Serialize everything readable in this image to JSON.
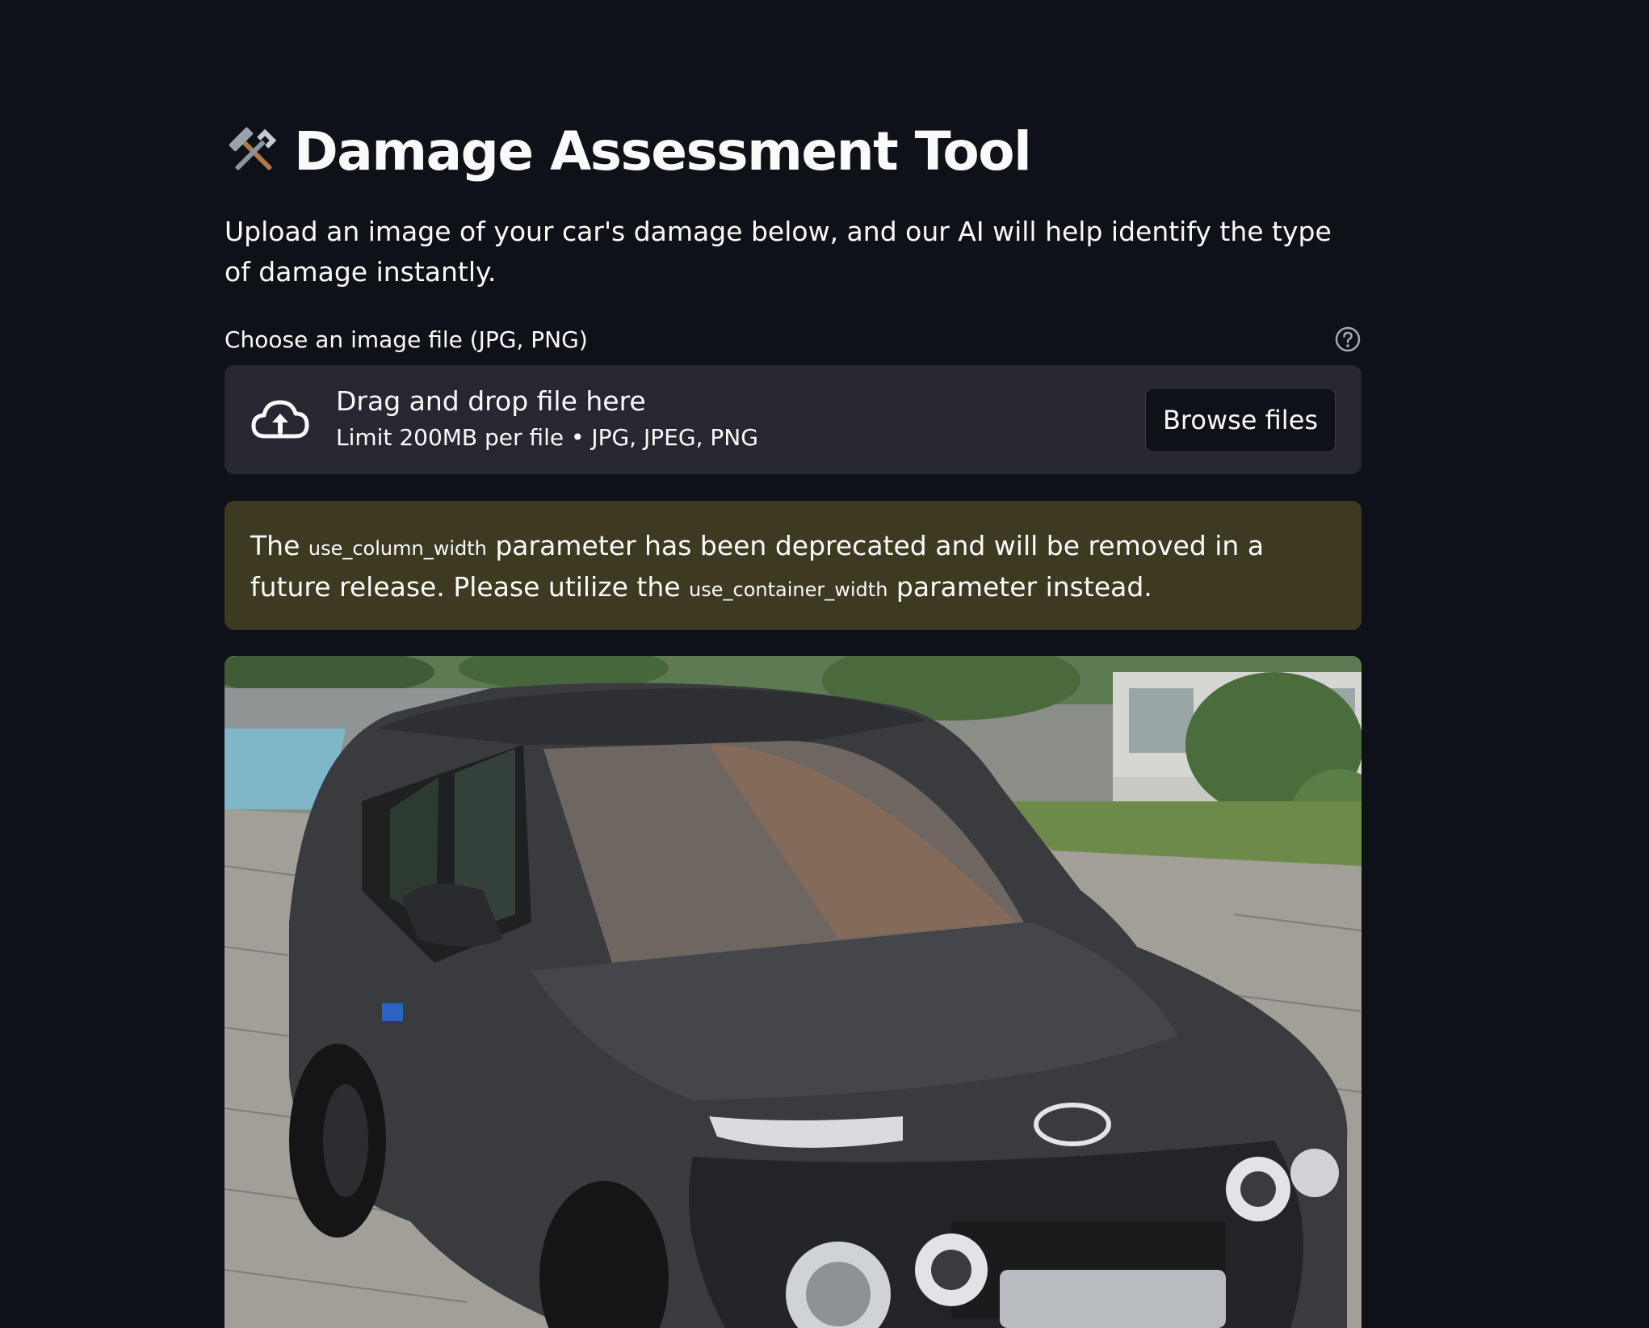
{
  "header": {
    "title": "Damage Assessment Tool",
    "title_icon": "hammer-and-wrench-icon"
  },
  "intro": {
    "text": "Upload an image of your car's damage below, and our AI will help identify the type of damage instantly."
  },
  "uploader": {
    "label": "Choose an image file (JPG, PNG)",
    "help_icon": "question-circle-icon",
    "dropzone_icon": "cloud-upload-icon",
    "drag_text": "Drag and drop file here",
    "limit_text": "Limit 200MB per file • JPG, JPEG, PNG",
    "browse_label": "Browse files"
  },
  "warning": {
    "part1": "The ",
    "code1": "use_column_width",
    "part2": " parameter has been deprecated and will be removed in a future release. Please utilize the ",
    "code2": "use_container_width",
    "part3": " parameter instead."
  },
  "image": {
    "subject": "car-photo"
  },
  "colors": {
    "background": "#0e1117",
    "dropzone": "#262730",
    "warning_bg": "#3e3a21",
    "text": "#fafafa"
  }
}
